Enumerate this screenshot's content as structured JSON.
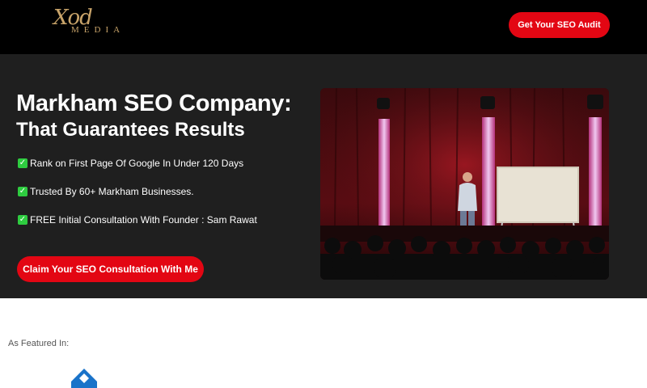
{
  "header": {
    "logo": {
      "script": "Xod",
      "wordmark": "MEDIA"
    },
    "cta_label": "Get Your SEO Audit"
  },
  "hero": {
    "title_line1": "Markham SEO Company:",
    "title_line2": "That Guarantees Results",
    "bullets": [
      {
        "icon": "check-mark-icon",
        "text": "Rank on First Page Of Google In Under 120 Days"
      },
      {
        "icon": "check-mark-icon",
        "text": "Trusted By 60+ Markham Businesses."
      },
      {
        "icon": "check-mark-icon",
        "text": "FREE Initial Consultation With Founder : Sam Rawat"
      }
    ],
    "cta_label": "Claim Your SEO Consultation With Me",
    "image": "speaker-on-stage-photo"
  },
  "featured": {
    "label": "As Featured In:"
  },
  "colors": {
    "accent": "#e30613",
    "header_bg": "#000000",
    "hero_bg": "#1f1f1f",
    "logo_gold": "#c9a46a",
    "check_green": "#2ecc40"
  }
}
